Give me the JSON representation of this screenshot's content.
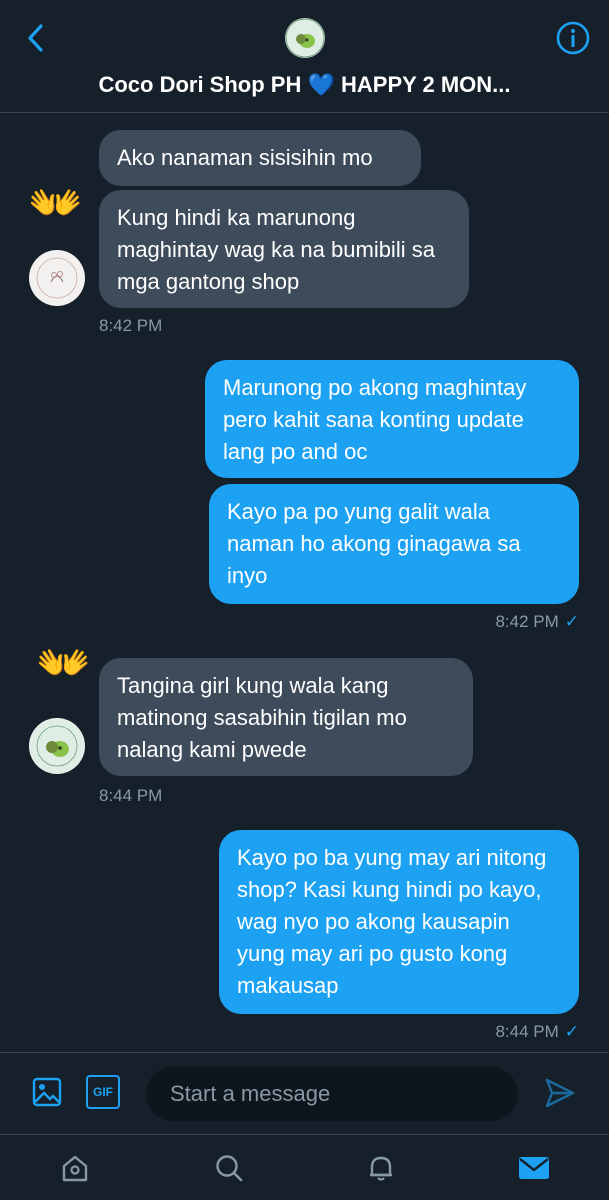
{
  "header": {
    "title": "Coco Dori Shop PH",
    "title_suffix": "HAPPY 2 MON...",
    "heart": "💙",
    "back_icon": "chevron-left-icon",
    "info_icon": "info-icon"
  },
  "messages": [
    {
      "id": "m1",
      "side": "in",
      "text": "Ako nanaman sisisihin mo"
    },
    {
      "id": "m2",
      "side": "in",
      "text": "Kung hindi ka marunong maghintay wag ka na bumibili sa mga gantong shop"
    },
    {
      "id": "t1",
      "time": "8:42 PM"
    },
    {
      "id": "m3",
      "side": "out",
      "text": "Marunong po akong maghintay pero kahit sana konting update lang po and oc"
    },
    {
      "id": "m4",
      "side": "out",
      "text": "Kayo pa po yung galit wala naman ho akong ginagawa sa inyo"
    },
    {
      "id": "t2",
      "time": "8:42 PM"
    },
    {
      "id": "m5",
      "side": "in",
      "text": "Tangina girl kung wala kang matinong sasabihin tigilan mo nalang kami pwede"
    },
    {
      "id": "t3",
      "time": "8:44 PM"
    },
    {
      "id": "m6",
      "side": "out",
      "text": "Kayo po ba yung may ari nitong shop? Kasi kung hindi po kayo, wag nyo po akong kausapin yung may ari po gusto kong makausap"
    },
    {
      "id": "t4",
      "time": "8:44 PM"
    }
  ],
  "texts": {
    "m1": "Ako nanaman sisisihin mo",
    "m2": "Kung hindi ka marunong maghintay wag ka na bumibili sa mga gantong shop",
    "t1": "8:42 PM",
    "m3": "Marunong po akong maghintay pero kahit sana konting update lang po and oc",
    "m4": "Kayo pa po yung galit wala naman ho akong ginagawa sa inyo",
    "t2": "8:42 PM",
    "m5": "Tangina girl kung wala kang matinong sasabihin tigilan mo nalang kami pwede",
    "t3": "8:44 PM",
    "m6": "Kayo po ba yung may ari nitong shop? Kasi kung hindi po kayo, wag nyo po akong kausapin yung may ari po gusto kong makausap",
    "t4": "8:44 PM"
  },
  "reaction_emoji": "👐",
  "read_mark": "✓",
  "composer": {
    "placeholder": "Start a message",
    "gif_label": "GIF"
  },
  "colors": {
    "background": "#15202b",
    "incoming_bubble": "#3d4b5a",
    "outgoing_bubble": "#1da1f2",
    "accent": "#1da1f2"
  },
  "nav": [
    "home-icon",
    "search-icon",
    "notifications-icon",
    "messages-icon"
  ]
}
